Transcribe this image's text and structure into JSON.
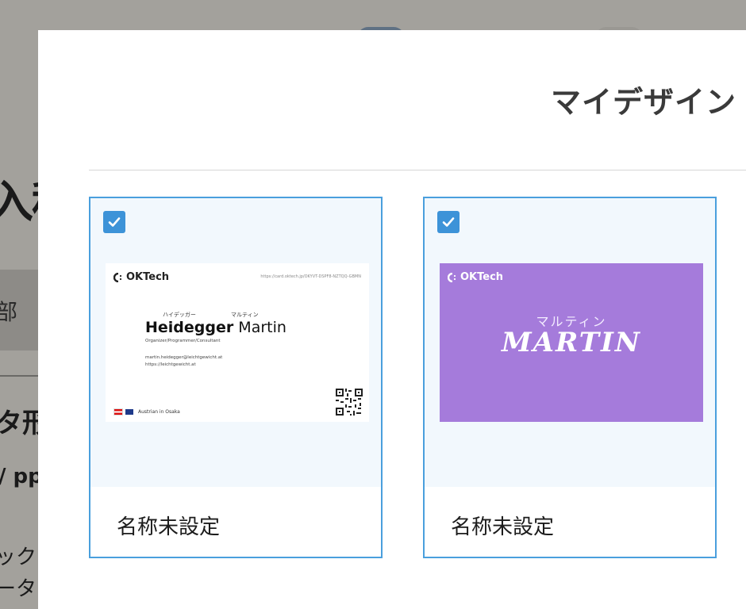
{
  "background": {
    "title_fragment": "入科",
    "tab_fragment": "部",
    "heading_fragment": "タ形",
    "ext_fragment": "/ pp",
    "line1_fragment": "ック",
    "line2_fragment": "ータ"
  },
  "modal": {
    "title": "マイデザイン"
  },
  "cards": [
    {
      "checked": true,
      "name": "名称未設定",
      "thumbnail": {
        "style": "white",
        "logo": "OKTech",
        "url": "https://card.oktech.jp/OKYVT-DSPF8-NZTQQ-GBMN",
        "kana_last": "ハイデッガー",
        "kana_first": "マルティン",
        "last_name": "Heidegger",
        "first_name": "Martin",
        "role": "Organizer/Programmer/Consultant",
        "email": "martin.heidegger@leichtgewicht.at",
        "website": "https://leichtgewicht.at",
        "location": "Austrian in Osaka"
      }
    },
    {
      "checked": true,
      "name": "名称未設定",
      "thumbnail": {
        "style": "purple",
        "logo": "OKTech",
        "kana": "マルティン",
        "name": "MARTIN",
        "bg_color": "#a57bdb"
      }
    }
  ],
  "colors": {
    "accent": "#4a9fdd",
    "checkbox": "#3d93d8",
    "overlay": "#a3a19c"
  }
}
